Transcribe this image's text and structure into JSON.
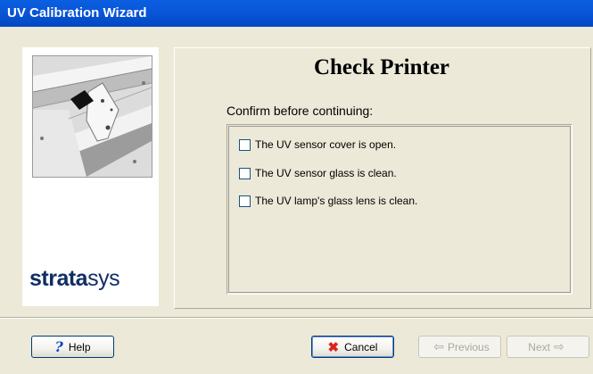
{
  "window": {
    "title": "UV Calibration Wizard"
  },
  "sidebar": {
    "logo_text_bold": "strata",
    "logo_text_light": "sys"
  },
  "content": {
    "heading": "Check Printer",
    "prompt": "Confirm before continuing:",
    "checklist": [
      {
        "label": "The UV sensor cover is open.",
        "checked": false
      },
      {
        "label": "The UV sensor glass is clean.",
        "checked": false
      },
      {
        "label": "The UV lamp's glass lens is clean.",
        "checked": false
      }
    ]
  },
  "buttons": {
    "help": "Help",
    "cancel": "Cancel",
    "previous": "Previous",
    "next": "Next"
  },
  "icons": {
    "help": "question-mark-icon",
    "cancel": "red-x-icon",
    "previous": "left-arrow-icon",
    "next": "right-arrow-icon"
  }
}
